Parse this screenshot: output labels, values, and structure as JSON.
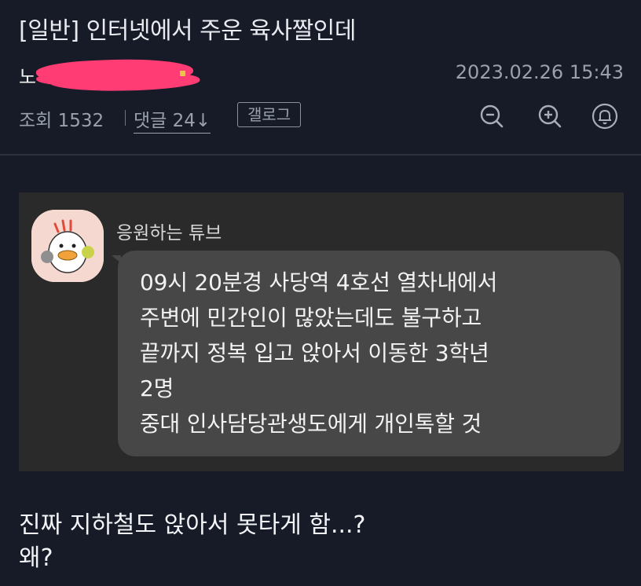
{
  "post": {
    "title": "[일반] 인터넷에서 주운 육사짤인데",
    "author_visible": "노",
    "date": "2023.02.26 15:43",
    "views": "조회 1532",
    "comments": "댓글 24",
    "comments_arrow": "↓",
    "gallog_label": "갤로그"
  },
  "toolbar": {
    "icons": [
      "zoom-out-icon",
      "zoom-in-icon",
      "bell-icon"
    ]
  },
  "chat": {
    "sender": "응원하는 튜브",
    "lines": [
      "09시 20분경 사당역 4호선 열차내에서",
      "주변에 민간인이 많았는데도 불구하고",
      "끝까지 정복 입고 앉아서 이동한 3학년",
      "2명",
      "중대 인사담당관생도에게 개인톡할 것"
    ]
  },
  "body": {
    "lines": [
      "진짜 지하철도 앉아서 못타게 함...?",
      "왜?"
    ]
  },
  "colors": {
    "background": "#161b27",
    "card": "#2a2a2a",
    "bubble": "#474747",
    "redaction": "#ff3c73"
  }
}
